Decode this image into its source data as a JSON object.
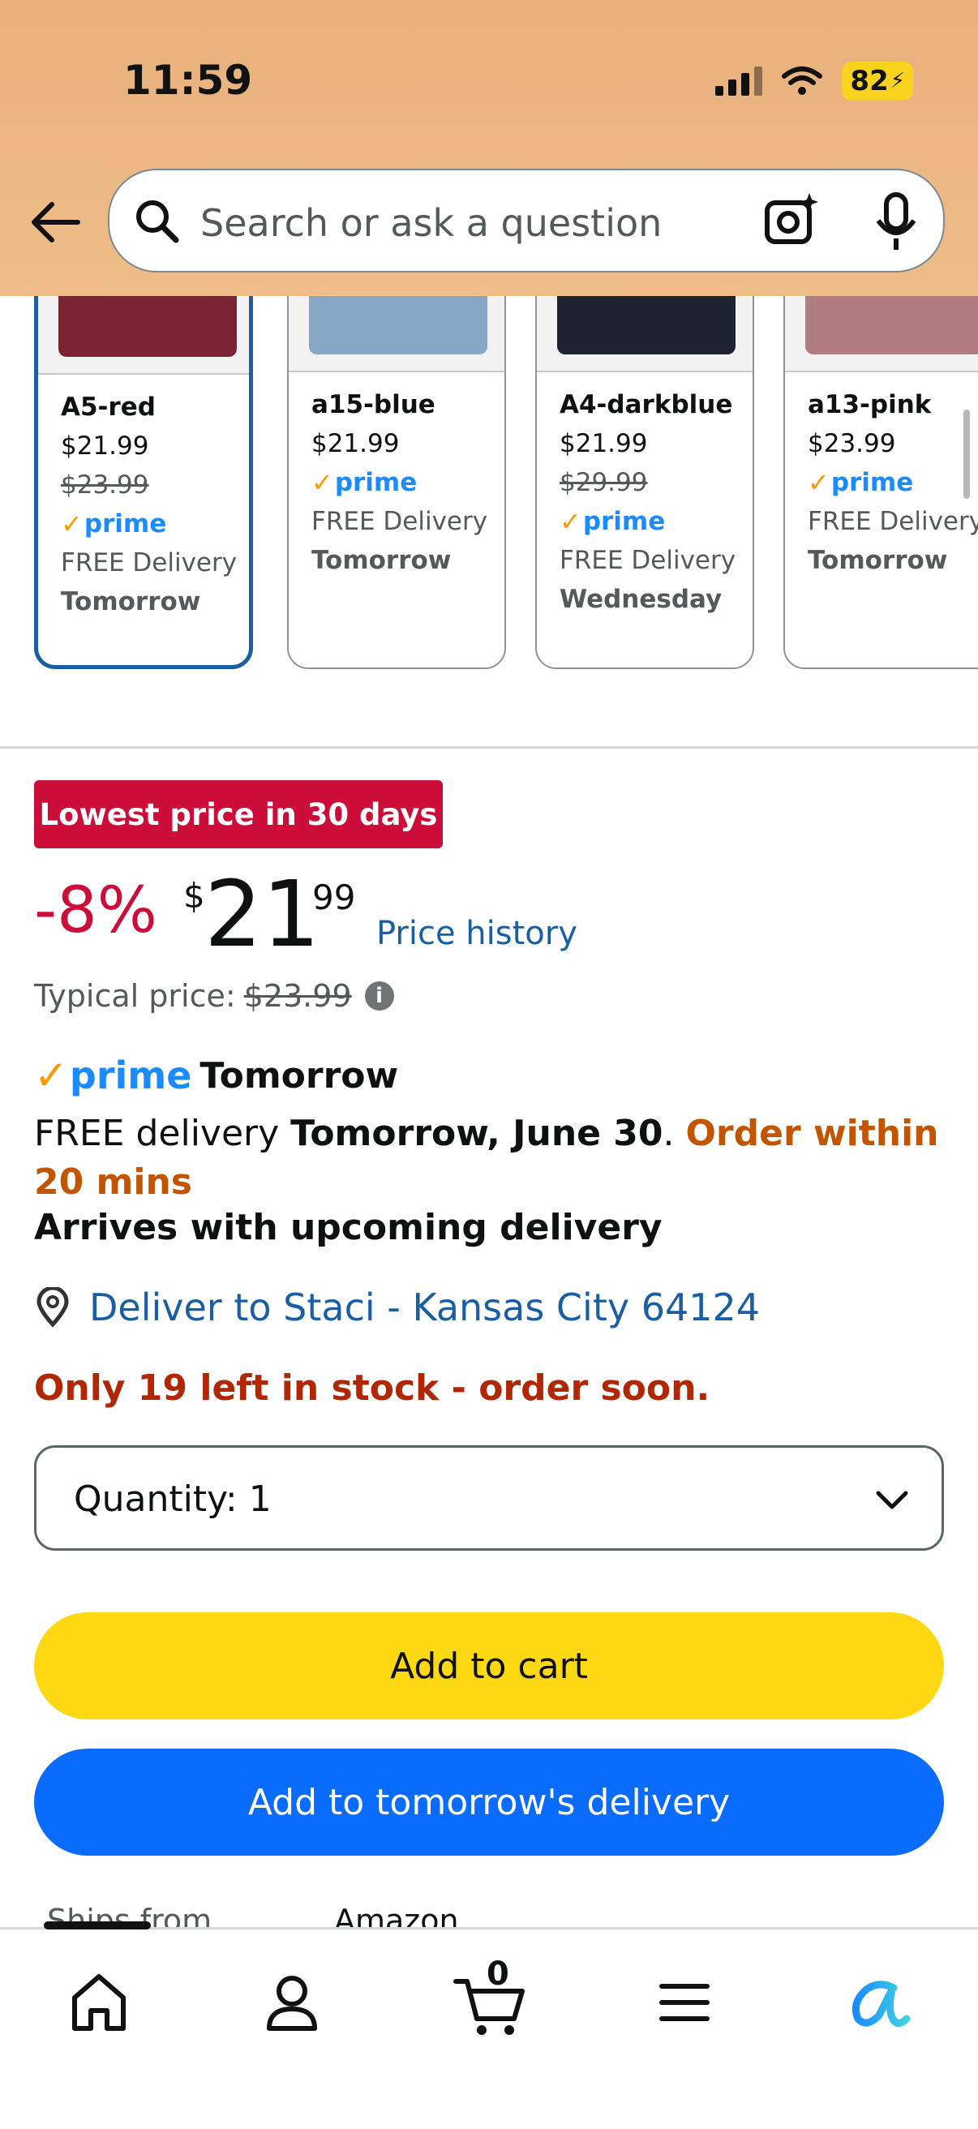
{
  "status": {
    "time": "11:59",
    "battery": "82"
  },
  "search": {
    "placeholder": "Search or ask a question"
  },
  "variants": [
    {
      "name": "A5-red",
      "price": "$21.99",
      "list_price": "$23.99",
      "prime": "prime",
      "delivery": "FREE Delivery",
      "day": "Tomorrow",
      "color": "#7a2431",
      "selected": true
    },
    {
      "name": "a15-blue",
      "price": "$21.99",
      "prime": "prime",
      "delivery": "FREE Delivery",
      "day": "Tomorrow",
      "color": "#86a8c6"
    },
    {
      "name": "A4-darkblue",
      "price": "$21.99",
      "list_price": "$29.99",
      "prime": "prime",
      "delivery": "FREE Delivery",
      "day": "Wednesday",
      "color": "#1e2231"
    },
    {
      "name": "a13-pink",
      "price": "$23.99",
      "prime": "prime",
      "delivery": "FREE Delivery",
      "day": "Tomorrow",
      "color": "#b07e80"
    }
  ],
  "deal": {
    "badge": "Lowest price in 30 days",
    "discount": "-8%",
    "currency": "$",
    "whole": "21",
    "fraction": "99",
    "price_history": "Price history",
    "typical_label": "Typical price:",
    "typical_value": "$23.99"
  },
  "delivery": {
    "prime_word": "prime",
    "prime_day": "Tomorrow",
    "free_prefix": "FREE delivery ",
    "date": "Tomorrow, June 30",
    "period": ". ",
    "urgency": "Order within 20 mins",
    "arrives": "Arrives with upcoming delivery",
    "deliver_to": "Deliver to Staci - Kansas City 64124"
  },
  "stock": "Only 19 left in stock - order soon.",
  "quantity": {
    "label": "Quantity:",
    "value": "1"
  },
  "buttons": {
    "add_to_cart": "Add to cart",
    "add_to_delivery": "Add to tomorrow's delivery"
  },
  "ships": {
    "label": "Ships from",
    "value": "Amazon"
  },
  "nav": {
    "cart_count": "0"
  }
}
